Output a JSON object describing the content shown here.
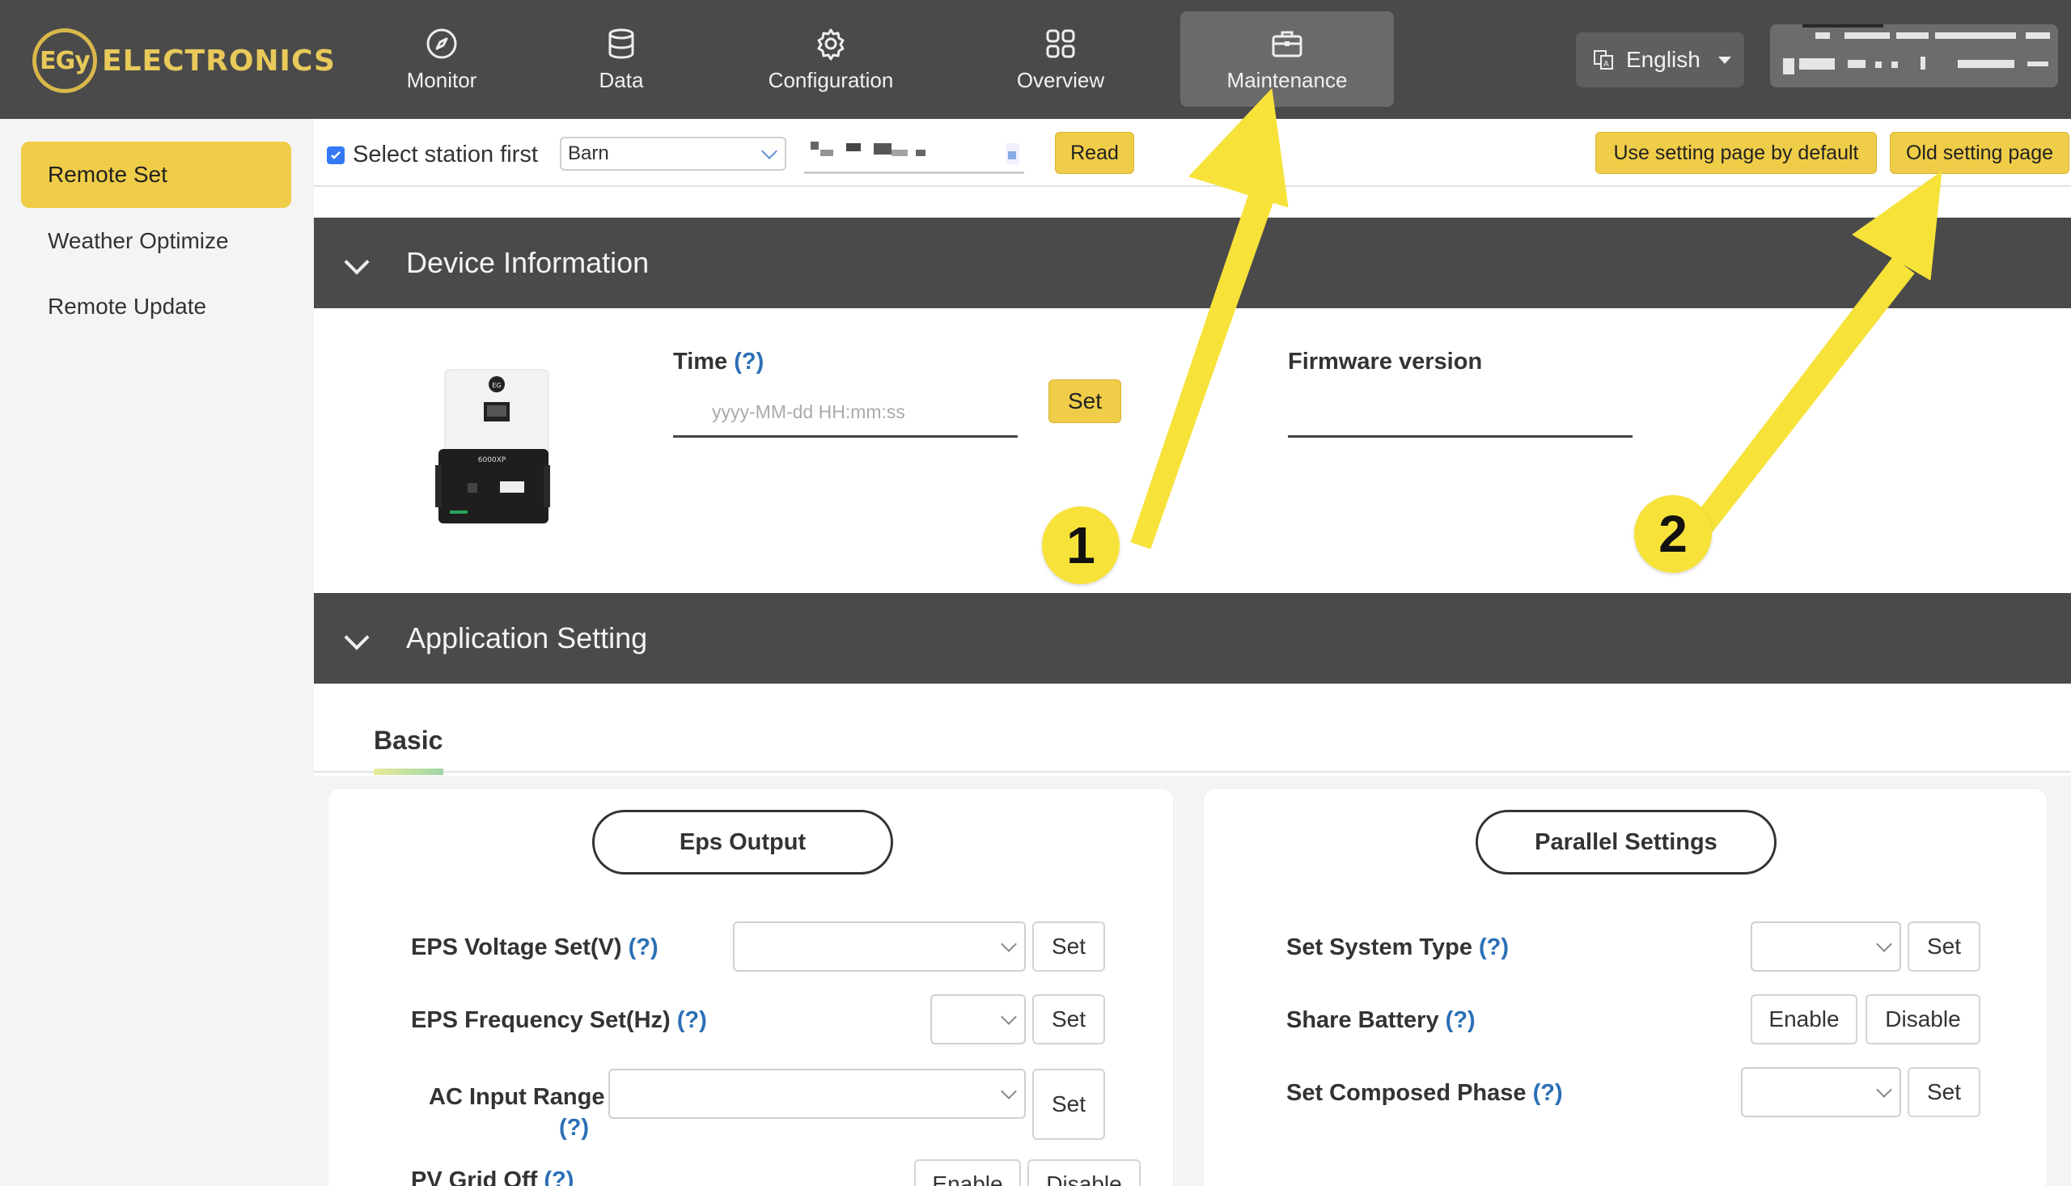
{
  "brand": {
    "logo_mark": "EGy",
    "logo_text": "ELECTRONICS"
  },
  "nav": [
    {
      "label": "Monitor",
      "icon": "compass-icon"
    },
    {
      "label": "Data",
      "icon": "database-icon"
    },
    {
      "label": "Configuration",
      "icon": "gear-icon"
    },
    {
      "label": "Overview",
      "icon": "grid-icon"
    },
    {
      "label": "Maintenance",
      "icon": "toolbox-icon",
      "active": true
    }
  ],
  "language": {
    "label": "English"
  },
  "sidebar": {
    "items": [
      {
        "label": "Remote Set",
        "active": true
      },
      {
        "label": "Weather Optimize"
      },
      {
        "label": "Remote Update"
      }
    ]
  },
  "toolbar": {
    "select_station_label": "Select station first",
    "station_value": "Barn",
    "read_label": "Read",
    "default_page_label": "Use setting page by default",
    "old_page_label": "Old setting page"
  },
  "device_info": {
    "title": "Device Information",
    "time_label": "Time",
    "help": "(?)",
    "time_placeholder": "yyyy-MM-dd HH:mm:ss",
    "set_label": "Set",
    "firmware_label": "Firmware version",
    "device_model": "6000XP"
  },
  "app_setting": {
    "title": "Application Setting",
    "tab": "Basic",
    "eps": {
      "title": "Eps Output",
      "rows": [
        {
          "label": "EPS Voltage Set(V)",
          "help": "(?)",
          "set": "Set"
        },
        {
          "label": "EPS Frequency Set(Hz)",
          "help": "(?)",
          "set": "Set"
        },
        {
          "label": "AC Input Range",
          "help": "(?)",
          "set": "Set"
        },
        {
          "label": "PV Grid Off",
          "help": "(?)",
          "enable": "Enable",
          "disable": "Disable"
        }
      ]
    },
    "parallel": {
      "title": "Parallel Settings",
      "rows": [
        {
          "label": "Set System Type",
          "help": "(?)",
          "set": "Set"
        },
        {
          "label": "Share Battery",
          "help": "(?)",
          "enable": "Enable",
          "disable": "Disable"
        },
        {
          "label": "Set Composed Phase",
          "help": "(?)",
          "set": "Set"
        }
      ]
    }
  },
  "annotations": {
    "one": "1",
    "two": "2",
    "arrow_color": "#f7e23a"
  }
}
